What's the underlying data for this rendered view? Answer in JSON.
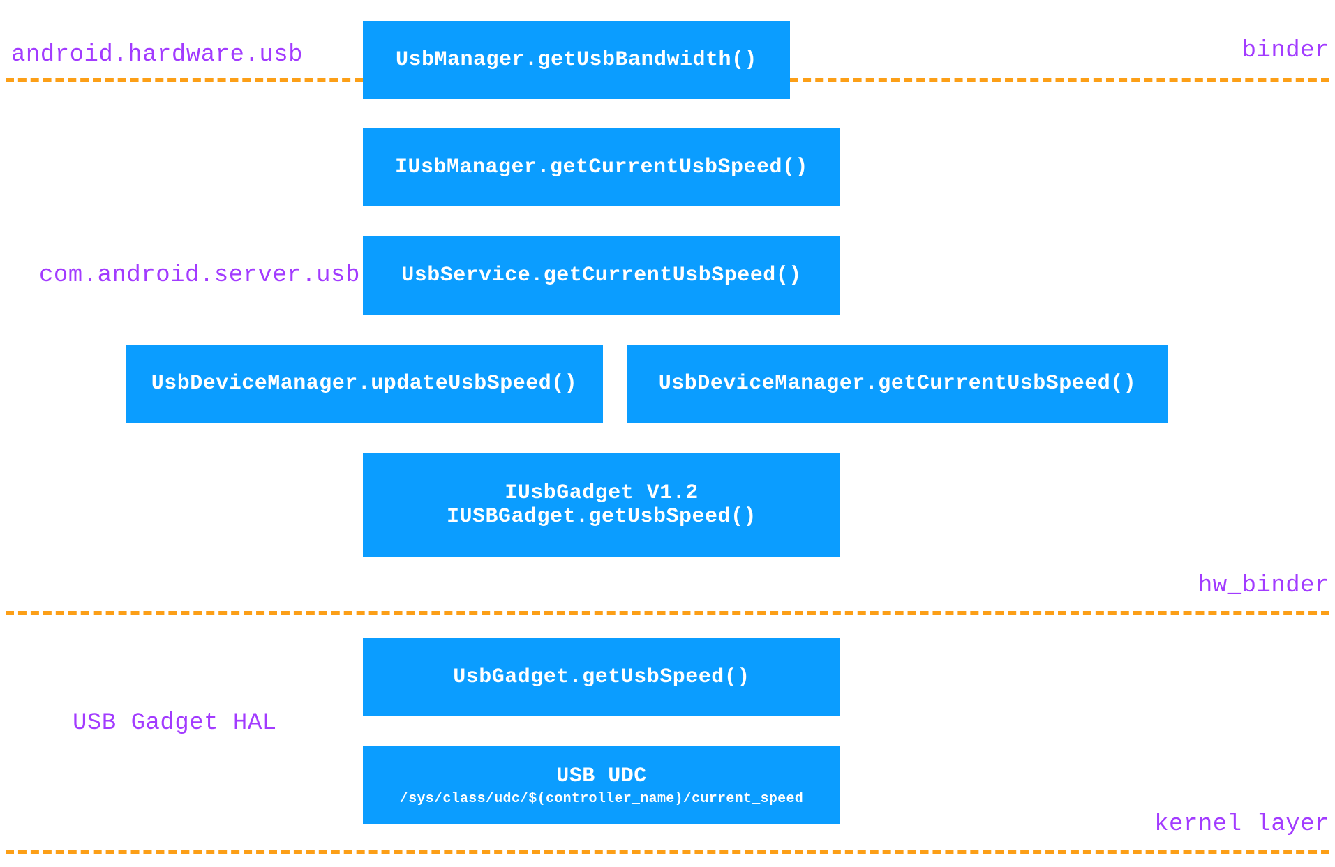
{
  "labels": {
    "left1": "android.hardware.usb",
    "left2": "com.android.server.usb",
    "left3": "USB Gadget HAL",
    "right1": "binder",
    "right2": "hw_binder",
    "right3": "kernel layer"
  },
  "boxes": {
    "b1": "UsbManager.getUsbBandwidth()",
    "b2": "IUsbManager.getCurrentUsbSpeed()",
    "b3": "UsbService.getCurrentUsbSpeed()",
    "b4": "UsbDeviceManager.updateUsbSpeed()",
    "b5": "UsbDeviceManager.getCurrentUsbSpeed()",
    "b6_l1": "IUsbGadget V1.2",
    "b6_l2": "IUSBGadget.getUsbSpeed()",
    "b7": "UsbGadget.getUsbSpeed()",
    "b8_l1": "USB UDC",
    "b8_l2": "/sys/class/udc/$(controller_name)/current_speed"
  }
}
